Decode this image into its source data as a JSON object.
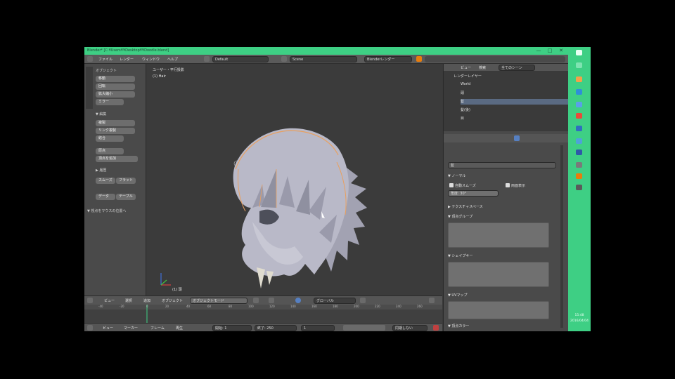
{
  "window": {
    "title": "Blender* [C:¥Users¥¥Desktop¥¥Doodle.blend]",
    "controls": [
      "—",
      "□",
      "✕"
    ]
  },
  "menubar": {
    "items": [
      "ファイル",
      "レンダー",
      "ウィンドウ",
      "ヘルプ"
    ],
    "layout_field": "Default",
    "scene_field": "Scene",
    "engine_field": "Blenderレンダー"
  },
  "toolshelf": {
    "tab_title": "オブジェクト",
    "buttons_a": [
      "移動",
      "回転",
      "拡大縮小",
      "ミラー"
    ],
    "section_edit": "▼ 編集",
    "buttons_b": [
      "複製",
      "リンク複製",
      "結合",
      "原点",
      "頂点を追加"
    ],
    "section_history": "▶ 履歴",
    "buttons_c": [
      "スムーズ",
      "フラット"
    ],
    "buttons_d": [
      "データ",
      "テーブル"
    ],
    "operator_panel": "▼ 視点をマウスの位置へ"
  },
  "viewport": {
    "view_label": "ユーザー・平行投影",
    "object_label": "(1) Hair",
    "axis_label": "(1) 頭"
  },
  "viewport_header": {
    "items": [
      "ビュー",
      "選択",
      "追加",
      "オブジェクト"
    ],
    "mode": "オブジェクトモード",
    "pivot": "グローバル"
  },
  "timeline": {
    "ticks": [
      "-40",
      "-20",
      "0",
      "20",
      "40",
      "60",
      "80",
      "100",
      "120",
      "140",
      "160",
      "180",
      "200",
      "220",
      "240",
      "260"
    ],
    "footer_items": [
      "ビュー",
      "マーカー",
      "フレーム",
      "再生"
    ],
    "start_label": "開始:",
    "start_value": "1",
    "end_label": "終了:",
    "end_value": "250",
    "current_frame": "1",
    "sync": "同期しない"
  },
  "outliner": {
    "header_items": [
      "ビュー",
      "検索",
      "全てのシーン"
    ],
    "rows": [
      "レンダーレイヤー",
      "World",
      "頭",
      "髪",
      "髪(後)",
      "目"
    ]
  },
  "properties": {
    "object_name": "髪",
    "section_mesh": "▼ ノーマル",
    "smooth_label": "自動スムーズ",
    "double_label": "両面表示",
    "angle_label": "角度:",
    "angle_value": "30°",
    "section_texspace": "▶ テクスチャスペース",
    "section_vgroups": "▼ 頂点グループ",
    "section_shapekeys": "▼ シェイプキー",
    "section_uv": "▼ UVマップ",
    "section_vcolors": "▼ 頂点カラー"
  },
  "taskbar": {
    "time": "15:48",
    "date": "2016/04/04"
  },
  "colors": {
    "accent_green": "#3ecf84",
    "blender_bg": "#3a3a3a",
    "selection_orange": "#e8a060",
    "model_grey": "#b9b9c8"
  }
}
